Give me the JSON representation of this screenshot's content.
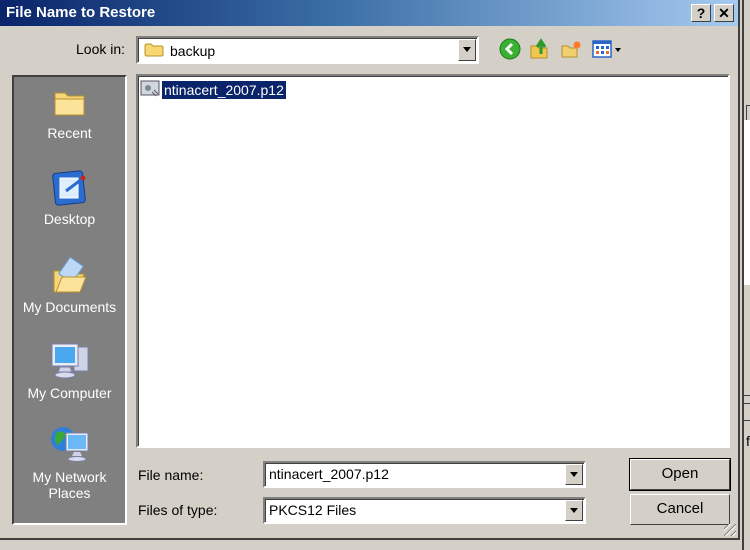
{
  "dialog": {
    "title": "File Name to Restore",
    "help_label": "?",
    "close_label": "✕"
  },
  "toolbar": {
    "lookin_label": "Look in:",
    "lookin_value": "backup",
    "icons": [
      "back-icon",
      "up-folder-icon",
      "new-folder-icon",
      "view-menu-icon"
    ]
  },
  "places": [
    {
      "label": "Recent",
      "icon": "recent-folder-icon"
    },
    {
      "label": "Desktop",
      "icon": "desktop-icon"
    },
    {
      "label": "My Documents",
      "icon": "my-documents-icon"
    },
    {
      "label": "My Computer",
      "icon": "my-computer-icon"
    },
    {
      "label": "My Network Places",
      "icon": "network-places-icon"
    }
  ],
  "files": [
    {
      "name": "ntinacert_2007.p12",
      "selected": true,
      "icon": "certificate-file-icon"
    }
  ],
  "form": {
    "filename_label": "File name:",
    "filename_value": "ntinacert_2007.p12",
    "filetype_label": "Files of type:",
    "filetype_value": "PKCS12 Files"
  },
  "buttons": {
    "open": "Open",
    "cancel": "Cancel"
  },
  "background": {
    "partial_text": "f"
  }
}
